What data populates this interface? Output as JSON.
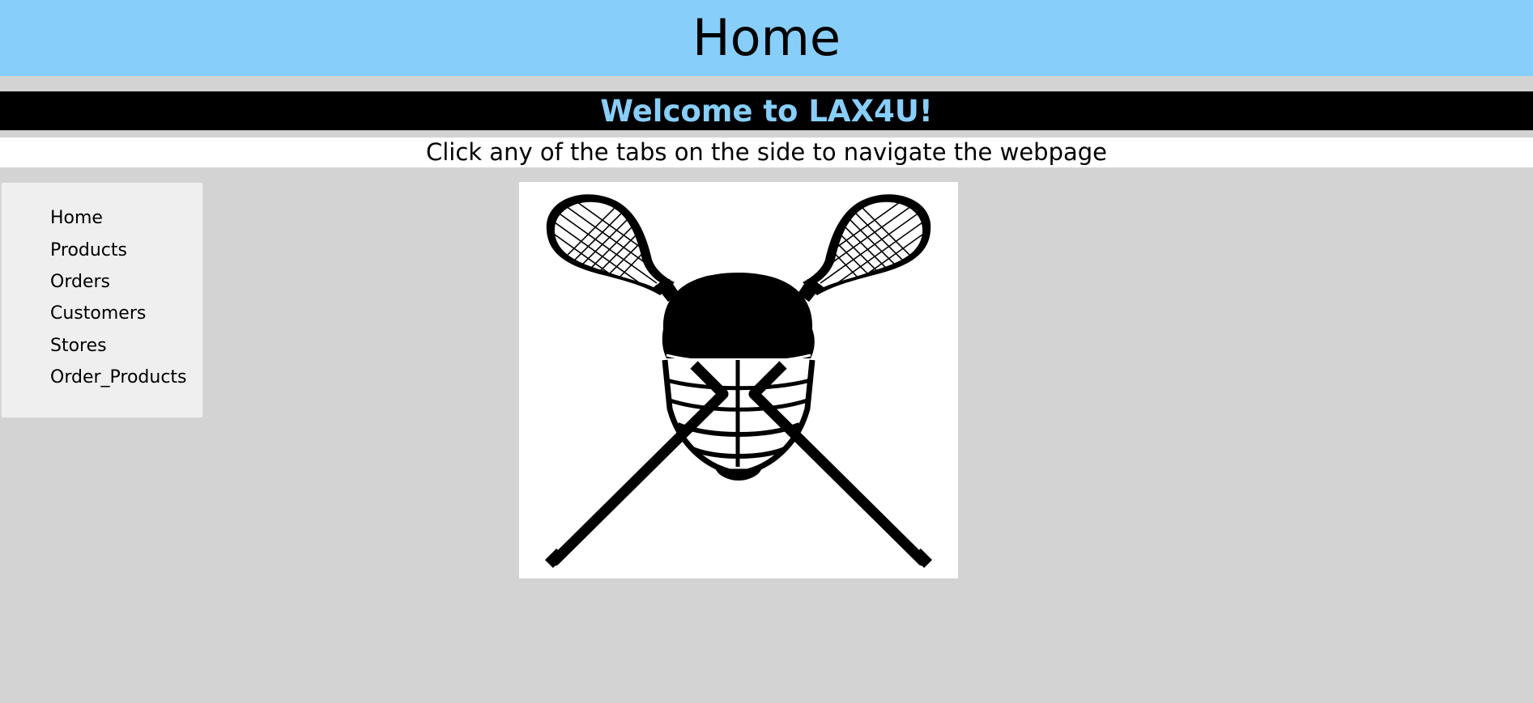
{
  "header": {
    "title": "Home"
  },
  "welcome": {
    "text": "Welcome to LAX4U!"
  },
  "instruction": {
    "text": "Click any of the tabs on the side to navigate the webpage"
  },
  "sidebar": {
    "items": [
      {
        "label": "Home"
      },
      {
        "label": "Products"
      },
      {
        "label": "Orders"
      },
      {
        "label": "Customers"
      },
      {
        "label": "Stores"
      },
      {
        "label": "Order_Products"
      }
    ]
  },
  "logo": {
    "icon": "lacrosse-crossed-sticks-helmet-icon"
  },
  "colors": {
    "header_bg": "#87cefa",
    "welcome_bg": "#000000",
    "welcome_text": "#87cefa",
    "page_bg": "#d3d3d3",
    "sidebar_bg": "#efefef"
  }
}
